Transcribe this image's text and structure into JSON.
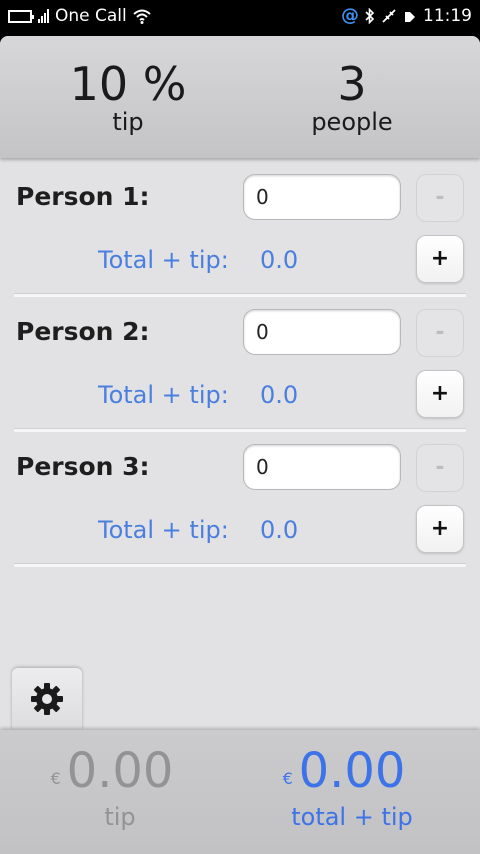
{
  "status_bar": {
    "carrier": "One Call",
    "time": "11:19",
    "icons": [
      "battery-icon",
      "signal-icon",
      "wifi-icon",
      "at-icon",
      "bluetooth-icon",
      "usb-icon",
      "silent-icon"
    ]
  },
  "header": {
    "tip_value": "10 %",
    "tip_label": "tip",
    "people_value": "3",
    "people_label": "people"
  },
  "persons": [
    {
      "name": "Person 1:",
      "amount": "0",
      "total_label": "Total + tip:",
      "total_value": "0.0",
      "minus_label": "-",
      "plus_label": "+"
    },
    {
      "name": "Person 2:",
      "amount": "0",
      "total_label": "Total + tip:",
      "total_value": "0.0",
      "minus_label": "-",
      "plus_label": "+"
    },
    {
      "name": "Person 3:",
      "amount": "0",
      "total_label": "Total + tip:",
      "total_value": "0.0",
      "minus_label": "-",
      "plus_label": "+"
    }
  ],
  "footer": {
    "currency": "€",
    "tip_total": "0.00",
    "tip_label": "tip",
    "grand_total": "0.00",
    "grand_total_label": "total + tip"
  },
  "colors": {
    "accent_blue": "#4a7fe0",
    "total_blue": "#3d73e8",
    "muted_gray": "#939393"
  }
}
